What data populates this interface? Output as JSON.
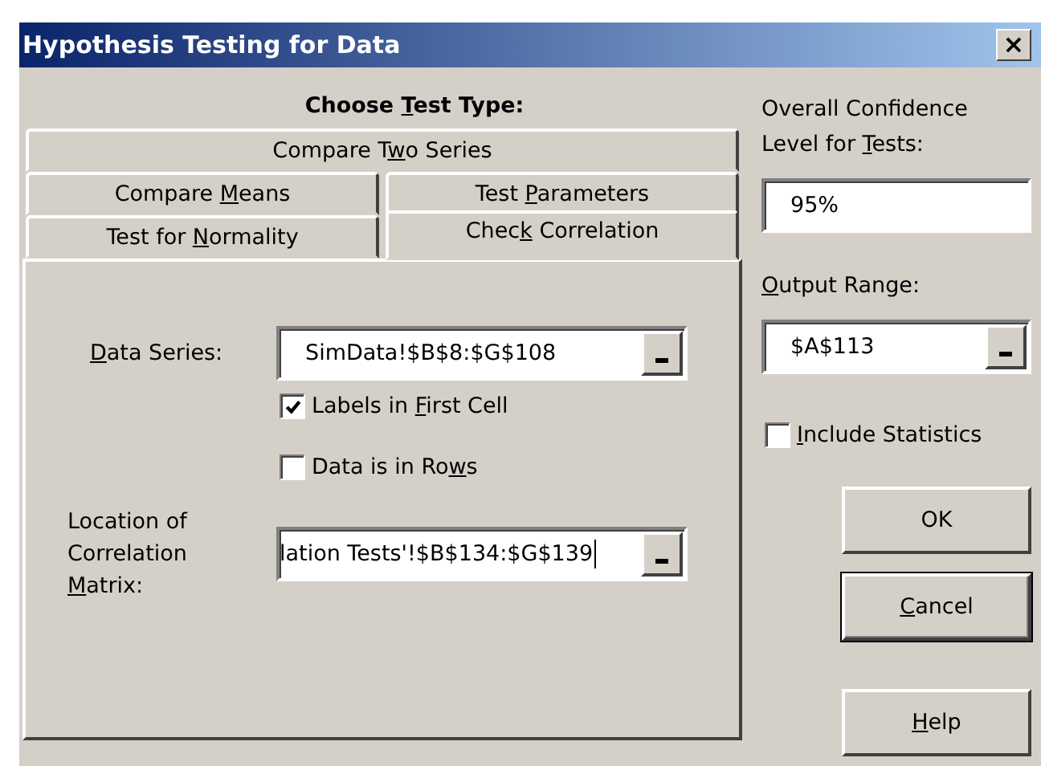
{
  "window": {
    "title": "Hypothesis Testing for Data",
    "close": "×"
  },
  "heading": {
    "pre": "Choose ",
    "key": "T",
    "post": "est Type:"
  },
  "tab_rows": [
    [
      {
        "pre": "Compare T",
        "key": "w",
        "post": "o Series",
        "selected": false
      }
    ],
    [
      {
        "pre": "Compare ",
        "key": "M",
        "post": "eans",
        "selected": false
      },
      {
        "pre": "Test ",
        "key": "P",
        "post": "arameters",
        "selected": false
      }
    ],
    [
      {
        "pre": "Test for ",
        "key": "N",
        "post": "ormality",
        "selected": false
      },
      {
        "pre": "Chec",
        "key": "k",
        "post": " Correlation",
        "selected": true
      }
    ]
  ],
  "data_series": {
    "label": {
      "key": "D",
      "post": "ata Series:"
    },
    "value": "SimData!$B$8:$G$108"
  },
  "checkboxes": [
    {
      "pre": "Labels in ",
      "key": "F",
      "post": "irst Cell",
      "checked": true
    },
    {
      "pre": "Data is in Ro",
      "key": "w",
      "post": "s",
      "checked": false
    }
  ],
  "matrix": {
    "label_lines": [
      "Location of",
      "Correlation"
    ],
    "label_last": {
      "key": "M",
      "post": "atrix:"
    },
    "value": "lation Tests'!$B$134:$G$139"
  },
  "confidence": {
    "label_line": "Overall Confidence",
    "label_last": {
      "pre": "Level for ",
      "key": "T",
      "post": "ests:"
    },
    "value": "95%"
  },
  "output_range": {
    "label": {
      "key": "O",
      "post": "utput Range:"
    },
    "value": "$A$113"
  },
  "include_statistics": {
    "key": "I",
    "post": "nclude Statistics",
    "checked": false
  },
  "buttons": [
    {
      "pre": "OK",
      "default": false
    },
    {
      "key": "C",
      "post": "ancel",
      "default": true
    },
    {
      "key": "H",
      "post": "elp",
      "default": false
    }
  ]
}
